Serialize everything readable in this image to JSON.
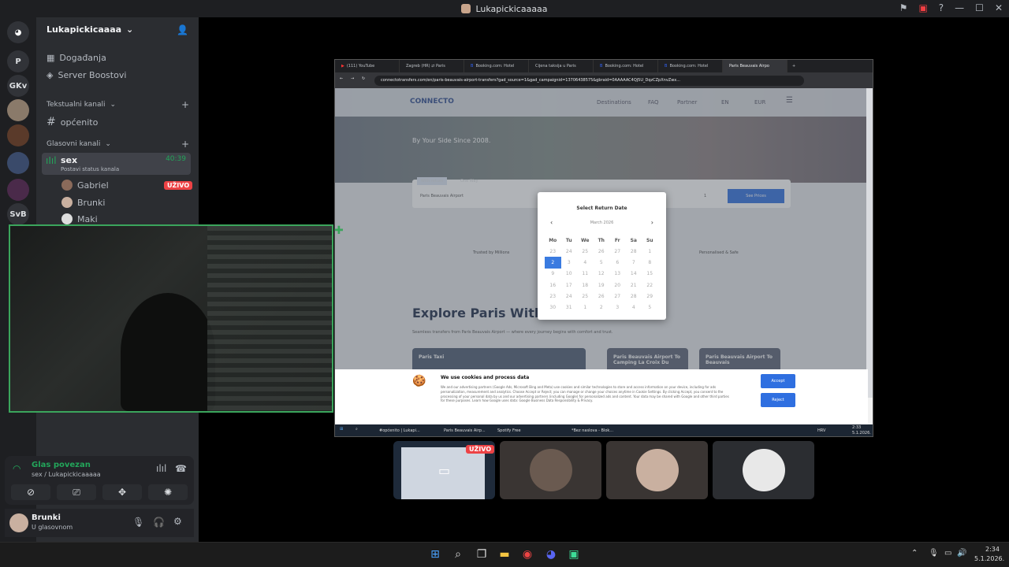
{
  "window": {
    "title": "Lukapickicaaaaa"
  },
  "rail": {
    "servers": [
      "P",
      "GKv",
      "SvB"
    ]
  },
  "server": {
    "name": "Lukapickicaaaa",
    "menu": [
      {
        "icon": "calendar-icon",
        "label": "Događanja"
      },
      {
        "icon": "boost-icon",
        "label": "Server Boostovi"
      }
    ],
    "text_category": "Tekstualni kanali",
    "text_channels": [
      "općenito"
    ],
    "voice_category": "Glasovni kanali",
    "voice_channel": {
      "name": "sex",
      "timer": "40:39",
      "status": "Postavi status kanala"
    },
    "voice_members": [
      {
        "name": "Gabriel",
        "live": "UŽIVO"
      },
      {
        "name": "Brunki"
      },
      {
        "name": "Maki"
      }
    ]
  },
  "voice_panel": {
    "status": "Glas povezan",
    "location": "sex / Lukapickicaaaaa"
  },
  "user_panel": {
    "name": "Brunki",
    "status": "U glasovnom"
  },
  "stream_badge": "UŽIVO",
  "browser": {
    "tabs": [
      "(111) YouTube",
      "Zagreb (HR) ⇄ Paris",
      "Booking.com: Hotel",
      "Cijena taksija u Paris",
      "Booking.com: Hotel",
      "Booking.com: Hotel",
      "Paris Beauvais Airpo"
    ],
    "url": "connectotransfers.com/en/paris-beauvais-airport-transfers?gad_source=1&gad_campaignid=13706438575&gbraid=0AAAAAC4Qj5U_DqzCZpXnvZwx...",
    "site": {
      "logo": "CONNECTO",
      "nav": [
        "Destinations",
        "FAQ",
        "Partner",
        "EN",
        "EUR"
      ],
      "tagline": "By Your Side Since 2008.",
      "booking_tabs": [
        "With return",
        "One Way"
      ],
      "from_field": "Paris Beauvais Airport",
      "passengers": "1",
      "search_button": "See Prices",
      "features": [
        "Trusted by Millions",
        "Personalised & Safe"
      ],
      "heading": "Explore Paris With",
      "subtext": "Seamless transfers from Paris Beauvais Airport — where every journey begins with comfort and trust.",
      "cards": [
        "Paris Taxi",
        "Paris Beauvais Airport To Camping La Croix Du",
        "Paris Beauvais Airport To Beauvais"
      ]
    },
    "calendar": {
      "title": "Select Return Date",
      "month": "March 2026",
      "weekdays": [
        "Mo",
        "Tu",
        "We",
        "Th",
        "Fr",
        "Sa",
        "Su"
      ],
      "weeks": [
        [
          "23",
          "24",
          "25",
          "26",
          "27",
          "28",
          "1"
        ],
        [
          "2",
          "3",
          "4",
          "5",
          "6",
          "7",
          "8"
        ],
        [
          "9",
          "10",
          "11",
          "12",
          "13",
          "14",
          "15"
        ],
        [
          "16",
          "17",
          "18",
          "19",
          "20",
          "21",
          "22"
        ],
        [
          "23",
          "24",
          "25",
          "26",
          "27",
          "28",
          "29"
        ],
        [
          "30",
          "31",
          "1",
          "2",
          "3",
          "4",
          "5"
        ]
      ],
      "selected": "2"
    },
    "cookie": {
      "title": "We use cookies and process data",
      "body": "We and our advertising partners (Google Ads, Microsoft Bing and Meta) use cookies and similar technologies to store and access information on your device, including for ads personalization, measurement and analytics. Choose Accept or Reject; you can manage or change your choices anytime in Cookie Settings. By clicking Accept, you consent to the processing of your personal data by us and our advertising partners (including Google) for personalized ads and content. Your data may be shared with Google and other third parties for these purposes. Learn how Google uses data: Google Business Data Responsibility & Privacy.",
      "accept": "Accept",
      "reject": "Reject"
    },
    "taskbar": {
      "items": [
        "#općenito | Lukapi...",
        "Paris Beauvais Airp...",
        "Spotify Free",
        "*Bez naslova - Blok..."
      ],
      "lang": "HRV",
      "time": "2:33",
      "date": "5.1.2026."
    }
  },
  "system": {
    "time": "2:34",
    "date": "5.1.2026."
  }
}
